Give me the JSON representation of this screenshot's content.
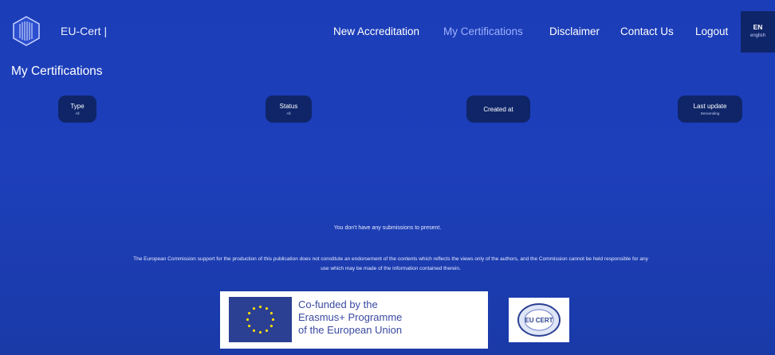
{
  "header": {
    "brand": "EU-Cert |",
    "nav": [
      "New Accreditation",
      "My Certifications",
      "Disclaimer",
      "Contact Us",
      "Logout"
    ],
    "active_nav": "My Certifications",
    "language": {
      "code": "EN",
      "name": "english"
    }
  },
  "page": {
    "title": "My Certifications"
  },
  "filters": [
    {
      "label": "Type",
      "value": "All"
    },
    {
      "label": "Status",
      "value": "All"
    },
    {
      "label": "Created at",
      "value": ""
    },
    {
      "label": "Last update",
      "value": "Descending"
    }
  ],
  "messages": {
    "empty": "You don't have any submissions to present.",
    "disclaimer": "The European Commission support for the production of this publication does not constitute an endorsement of the contents which reflects the views only of the authors, and the Commission cannot be held responsible for any use which may be made of the information contained therein."
  },
  "footer": {
    "cofund_lines": [
      "Co-funded by the",
      "Erasmus+ Programme",
      "of the European Union"
    ],
    "partner_logo_text": "EU CERT"
  },
  "colors": {
    "background": "#1b3db8",
    "pill": "#0f2568",
    "active_nav": "#9fb2ff",
    "lang_box": "#0f2569"
  }
}
